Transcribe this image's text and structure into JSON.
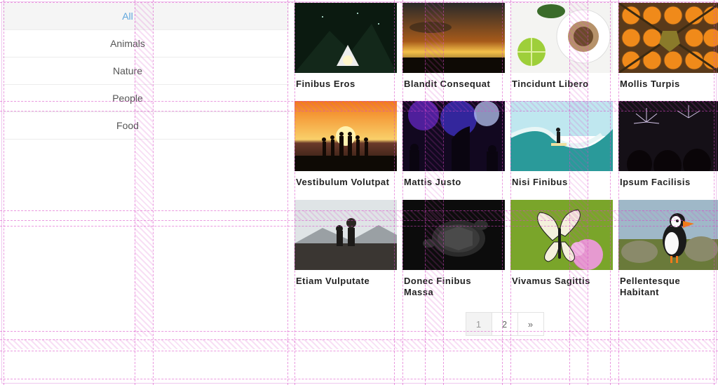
{
  "sidebar": {
    "filters": [
      {
        "label": "All",
        "active": true
      },
      {
        "label": "Animals",
        "active": false
      },
      {
        "label": "Nature",
        "active": false
      },
      {
        "label": "People",
        "active": false
      },
      {
        "label": "Food",
        "active": false
      }
    ]
  },
  "grid": {
    "cards": [
      {
        "title": "Finibus Eros",
        "icon": "night-camp"
      },
      {
        "title": "Blandit Consequat",
        "icon": "sunset-clouds"
      },
      {
        "title": "Tincidunt Libero",
        "icon": "coffee-lime"
      },
      {
        "title": "Mollis Turpis",
        "icon": "oranges"
      },
      {
        "title": "Vestibulum Volutpat",
        "icon": "family-sunset"
      },
      {
        "title": "Mattis Justo",
        "icon": "concert"
      },
      {
        "title": "Nisi Finibus",
        "icon": "surf-wave"
      },
      {
        "title": "Ipsum Facilisis",
        "icon": "fireworks-crowd"
      },
      {
        "title": "Etiam Vulputate",
        "icon": "couple-mountain"
      },
      {
        "title": "Donec Finibus Massa",
        "icon": "turtle"
      },
      {
        "title": "Vivamus Sagittis",
        "icon": "butterfly"
      },
      {
        "title": "Pellentesque Habitant",
        "icon": "puffin"
      }
    ]
  },
  "pager": {
    "pages": [
      "1",
      "2"
    ],
    "active": "1",
    "next_glyph": "»"
  }
}
